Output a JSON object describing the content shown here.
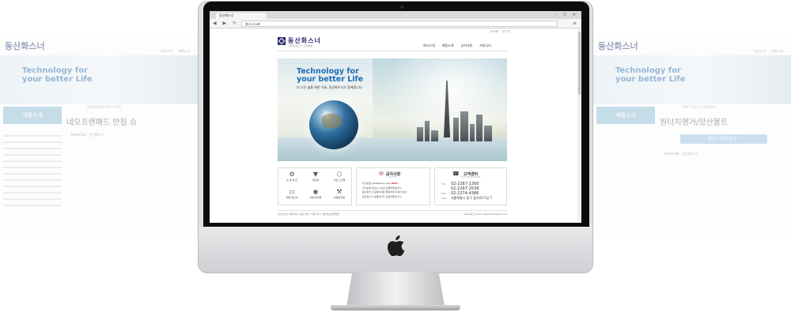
{
  "background_left": {
    "logo": "동산화스너",
    "nav": "회사소개 제품소개",
    "banner_title": "Technology for your better Life",
    "category": "제품소개",
    "heading": "네오프랜패드 반침 슈",
    "subheading": "NEOPRENE PAD SHOE",
    "model": "Model No : 동산화스너",
    "sidebar_lines": 12
  },
  "background_right": {
    "logo": "동산화스너",
    "nav": "회사소개 제품소개",
    "banner_title": "Technology for your better Life",
    "category": "제품소개",
    "heading": "원터치행거/앙산볼트",
    "subheading": "ONE TOUCH HANGER",
    "model": "Model No : 동산화스너",
    "button_label": "원터치 행거 안내 ?"
  },
  "browser": {
    "tab_title": "동산화스너",
    "url": "화스너.net",
    "window_controls": "– ☐ ✕",
    "menu": "≡"
  },
  "site": {
    "top_links": "HOME  로그인",
    "logo_name": "동산화스너",
    "logo_tagline": "기술과 화스너, 고객만족",
    "nav": [
      "회사소개",
      "제품소개",
      "공지사항",
      "커뮤니티"
    ],
    "hero_title_line1": "Technology for",
    "hero_title_line2": "your better Life",
    "hero_subtitle": "더 나은 삶을 위한 기술, 동산화스너가 함께합니다.",
    "product_icons": [
      {
        "glyph": "⚙",
        "label": "소 잡 볼 트"
      },
      {
        "glyph": "▼",
        "label": "볼트류"
      },
      {
        "glyph": "⬡",
        "label": "너트·스크류"
      },
      {
        "glyph": "▭",
        "label": "자동 화스너"
      },
      {
        "glyph": "◉",
        "label": "자동 방지류"
      },
      {
        "glyph": "⚒",
        "label": "건축용 볼트"
      }
    ],
    "notice": {
      "title": "공지사항",
      "subtitle": "NOTICE",
      "items": [
        "주소변경 (dsfastener.net)",
        "주소변경 화스너.net로 변경되었습니다.",
        "동산화스너 홈페이지를 방문하여 주셔서 감사",
        "동산화스너 홈페이지가 오픈되었습니다."
      ],
      "new_badge": "NEW"
    },
    "contact": {
      "title": "고객센터",
      "subtitle": "CUSTOMER CENTER",
      "tel_label": "TEL.",
      "tel1": "02-2267-1300",
      "tel2": "02-2267-2539",
      "fax_label": "FAX.",
      "fax": "02-2274-4386",
      "add_label": "ADD.",
      "address": "서울특별시 중구 을지로17길 7"
    },
    "footer_left": "회사소개 | 이용약관 | 공지사항 | 커뮤니티 | 개인정보취급방침",
    "footer_right": "www.화스너.net | www.dsfastener.net"
  },
  "colors": {
    "brand": "#2a2f6e",
    "hero_title": "#1c6db5",
    "category_tab": "#7fb2cf"
  },
  "icons": {
    "apple_logo": "apple-icon",
    "notice": "megaphone-icon",
    "contact": "phone-icon"
  }
}
